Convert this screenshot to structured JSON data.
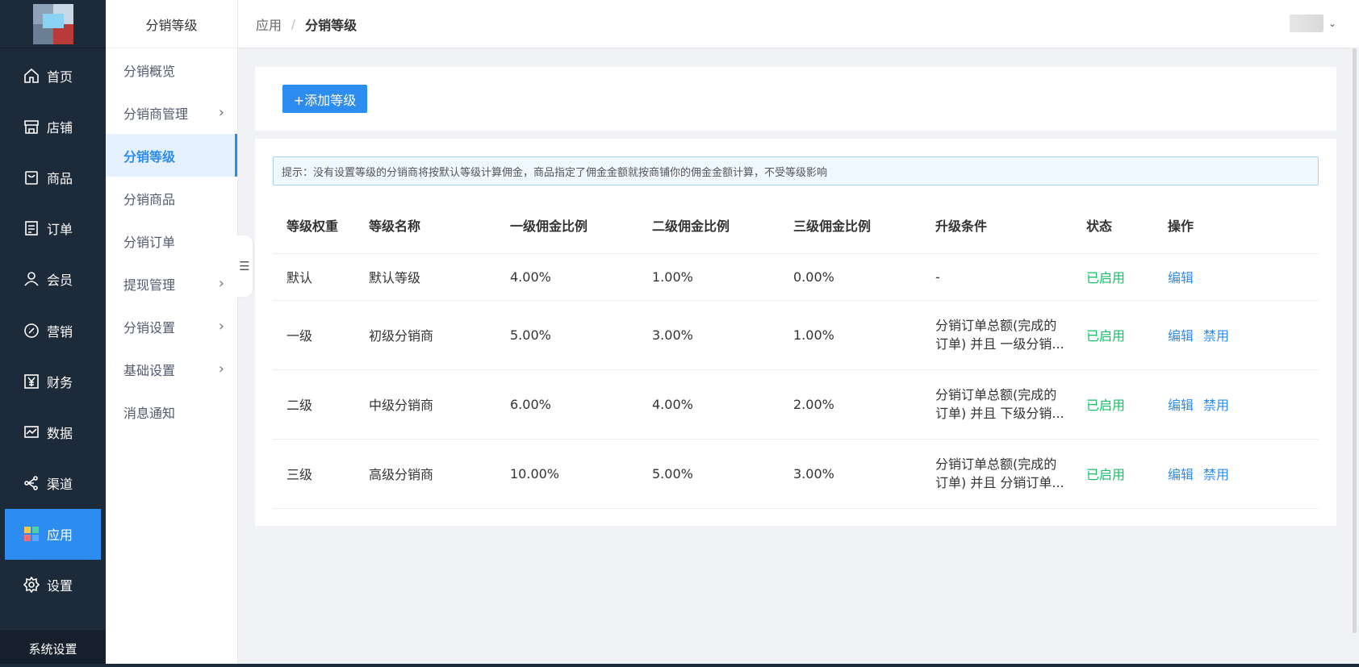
{
  "sidebar": {
    "items": [
      {
        "label": "首页",
        "icon": "home-icon"
      },
      {
        "label": "店铺",
        "icon": "store-icon"
      },
      {
        "label": "商品",
        "icon": "bag-icon"
      },
      {
        "label": "订单",
        "icon": "order-icon"
      },
      {
        "label": "会员",
        "icon": "user-icon"
      },
      {
        "label": "营销",
        "icon": "marketing-icon"
      },
      {
        "label": "财务",
        "icon": "yen-icon"
      },
      {
        "label": "数据",
        "icon": "chart-icon"
      },
      {
        "label": "渠道",
        "icon": "share-icon"
      },
      {
        "label": "应用",
        "icon": "apps-icon",
        "active": true
      },
      {
        "label": "设置",
        "icon": "gear-icon"
      }
    ],
    "footer": "系统设置"
  },
  "submenu": {
    "title": "分销等级",
    "items": [
      {
        "label": "分销概览"
      },
      {
        "label": "分销商管理"
      },
      {
        "label": "分销等级"
      },
      {
        "label": "分销商品"
      },
      {
        "label": "分销订单"
      },
      {
        "label": "提现管理"
      },
      {
        "label": "分销设置"
      },
      {
        "label": "基础设置"
      },
      {
        "label": "消息通知"
      }
    ]
  },
  "header": {
    "breadcrumb_parent": "应用",
    "breadcrumb_sep": "/",
    "breadcrumb_current": "分销等级"
  },
  "toolbar": {
    "add_label": "+添加等级"
  },
  "tip": "提示：没有设置等级的分销商将按默认等级计算佣金，商品指定了佣金金额就按商铺你的佣金金额计算，不受等级影响",
  "table": {
    "columns": [
      "等级权重",
      "等级名称",
      "一级佣金比例",
      "二级佣金比例",
      "三级佣金比例",
      "升级条件",
      "状态",
      "操作"
    ],
    "rows": [
      {
        "weight": "默认",
        "name": "默认等级",
        "r1": "4.00%",
        "r2": "1.00%",
        "r3": "0.00%",
        "condition": "-",
        "status": "已启用",
        "edit": "编辑"
      },
      {
        "weight": "一级",
        "name": "初级分销商",
        "r1": "5.00%",
        "r2": "3.00%",
        "r3": "1.00%",
        "condition": "分销订单总额(完成的\n订单) 并且 一级分销...",
        "status": "已启用",
        "edit": "编辑",
        "disable": "禁用"
      },
      {
        "weight": "二级",
        "name": "中级分销商",
        "r1": "6.00%",
        "r2": "4.00%",
        "r3": "2.00%",
        "condition": "分销订单总额(完成的\n订单) 并且 下级分销...",
        "status": "已启用",
        "edit": "编辑",
        "disable": "禁用"
      },
      {
        "weight": "三级",
        "name": "高级分销商",
        "r1": "10.00%",
        "r2": "5.00%",
        "r3": "3.00%",
        "condition": "分销订单总额(完成的\n订单) 并且 分销订单...",
        "status": "已启用",
        "edit": "编辑",
        "disable": "禁用"
      }
    ]
  },
  "colors": {
    "sidebar_bg": "#1d2a3a",
    "accent": "#2d8cf0",
    "status_enabled": "#19be6b",
    "active_submenu_bg": "#e5f1fd"
  }
}
